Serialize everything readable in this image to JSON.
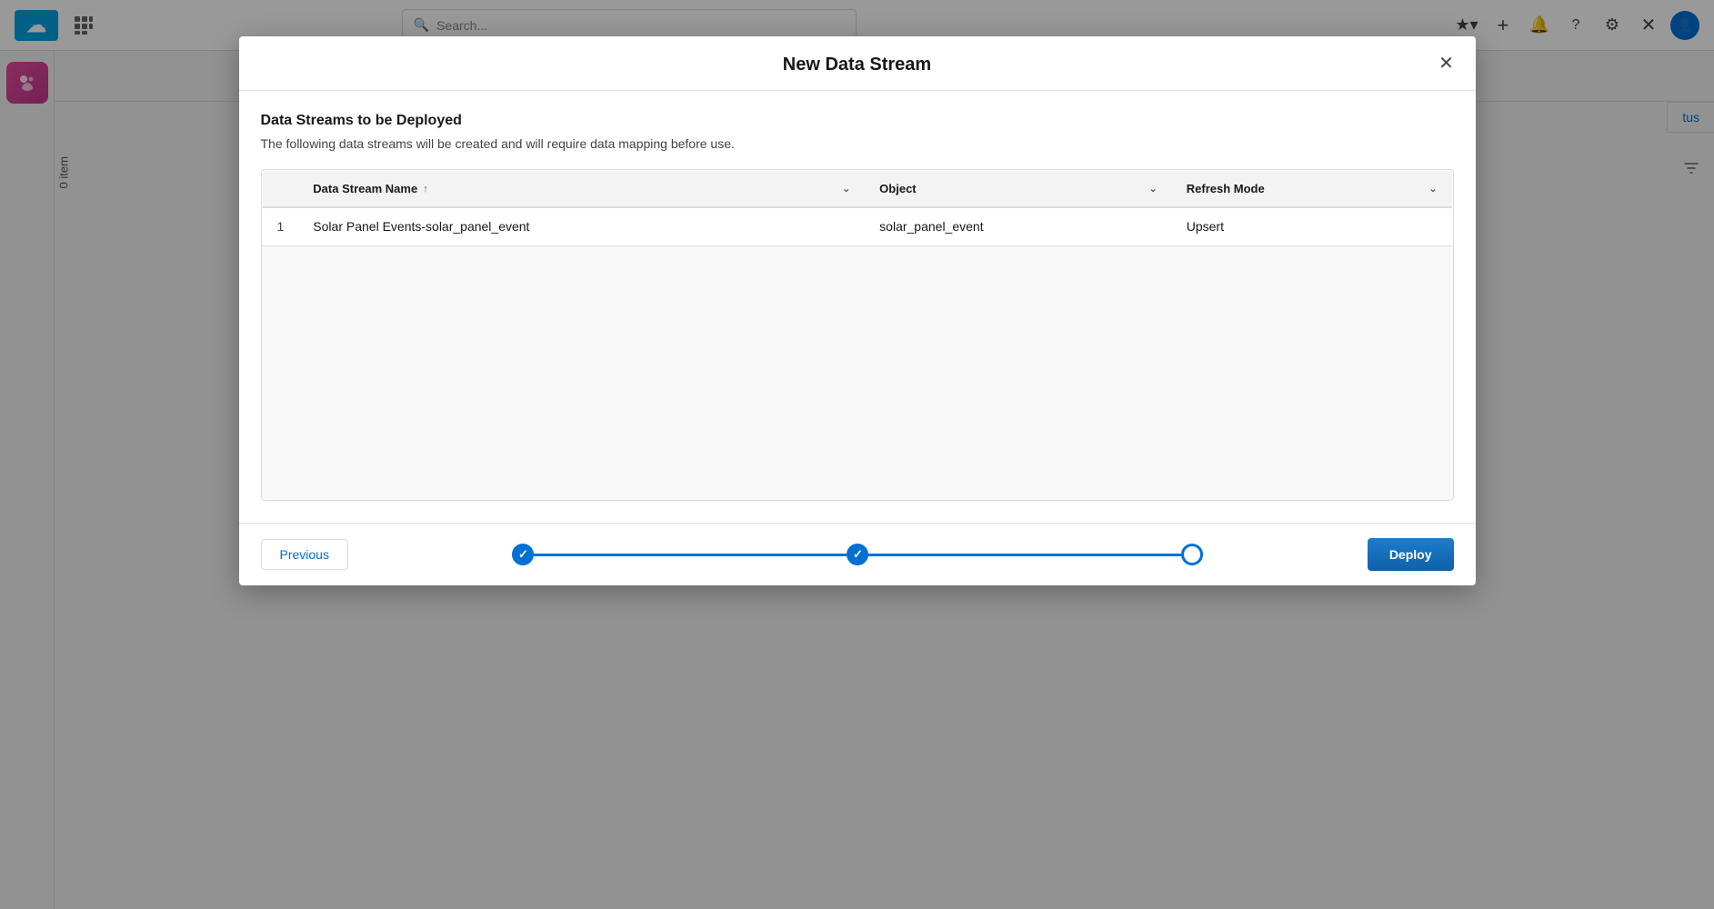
{
  "app": {
    "title": "Salesforce",
    "search_placeholder": "Search..."
  },
  "header": {
    "icons": [
      "★",
      "＋",
      "🔔",
      "?",
      "⚙",
      "✕",
      "👤"
    ]
  },
  "sidebar": {
    "items_count": "0 item"
  },
  "modal": {
    "title": "New Data Stream",
    "close_label": "✕",
    "section_title": "Data Streams to be Deployed",
    "section_subtitle": "The following data streams will be created and will require data mapping before use.",
    "table": {
      "columns": [
        {
          "label": "Data Stream Name",
          "sort": true,
          "chevron": true
        },
        {
          "label": "Object",
          "sort": false,
          "chevron": true
        },
        {
          "label": "Refresh Mode",
          "sort": false,
          "chevron": true
        }
      ],
      "rows": [
        {
          "num": "1",
          "name": "Solar Panel Events-solar_panel_event",
          "object": "solar_panel_event",
          "refresh_mode": "Upsert"
        }
      ]
    },
    "footer": {
      "previous_label": "Previous",
      "deploy_label": "Deploy"
    },
    "progress": {
      "steps": [
        {
          "state": "completed"
        },
        {
          "state": "completed"
        },
        {
          "state": "active"
        }
      ]
    }
  },
  "background_label": {
    "status": "tus",
    "items": "0 item"
  }
}
